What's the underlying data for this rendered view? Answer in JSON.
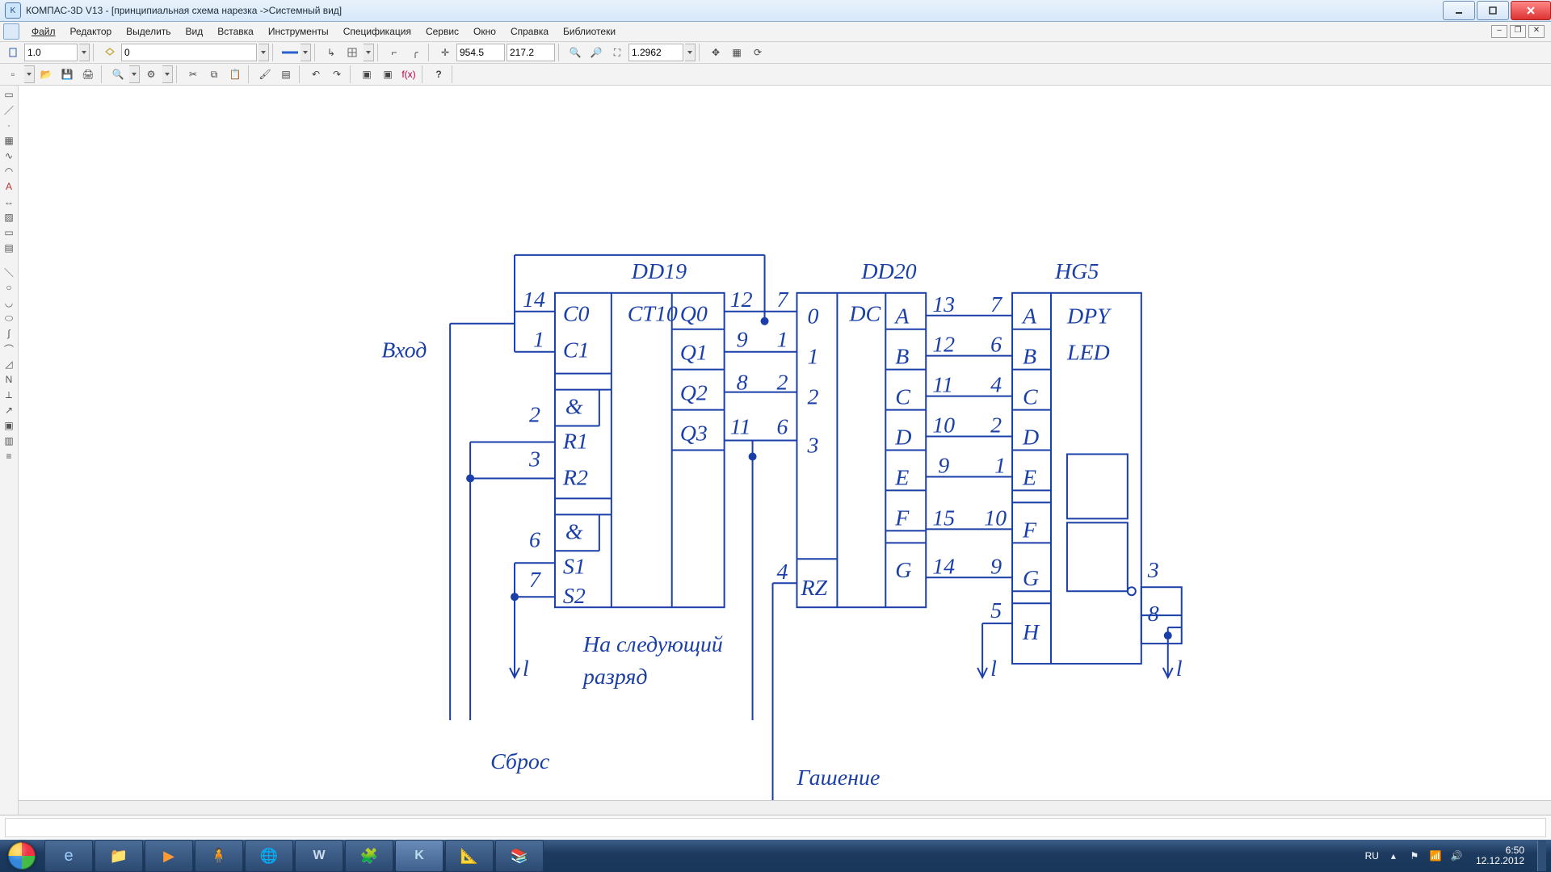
{
  "title": "КОМПАС-3D V13 - [принципиальная схема нарезка ->Системный вид]",
  "menu": [
    "Файл",
    "Редактор",
    "Выделить",
    "Вид",
    "Вставка",
    "Инструменты",
    "Спецификация",
    "Сервис",
    "Окно",
    "Справка",
    "Библиотеки"
  ],
  "toolbar1": {
    "scale": "1.0",
    "layer": "0",
    "coordX": "954.5",
    "coordY": "217.2",
    "zoom": "1.2962"
  },
  "schematic": {
    "labels": {
      "dd19": "DD19",
      "dd20": "DD20",
      "hg5": "HG5",
      "ct10": "CT10",
      "dc": "DC",
      "dpy": "DPY",
      "led": "LED",
      "input": "Вход",
      "next1": "На следующий",
      "next2": "разряд",
      "reset": "Сброс",
      "blank": "Гашение"
    },
    "dd19_left": [
      "C0",
      "C1",
      "&",
      "R1",
      "R2",
      "&",
      "S1",
      "S2"
    ],
    "dd19_leftpins": [
      "14",
      "1",
      "2",
      "3",
      "6",
      "7"
    ],
    "dd19_q": [
      "Q0",
      "Q1",
      "Q2",
      "Q3"
    ],
    "dd19_qpins": [
      "12",
      "9",
      "8",
      "11"
    ],
    "dd20_in": [
      "0",
      "1",
      "2",
      "3",
      "RZ"
    ],
    "dd20_inpins": [
      "7",
      "1",
      "2",
      "6",
      "4"
    ],
    "dd20_out": [
      "A",
      "B",
      "C",
      "D",
      "E",
      "F",
      "G"
    ],
    "dd20_outpins_l": [
      "13",
      "12",
      "11",
      "10",
      "9",
      "15",
      "14"
    ],
    "dd20_outpins_r": [
      "7",
      "6",
      "4",
      "2",
      "1",
      "10",
      "9"
    ],
    "hg5_in": [
      "A",
      "B",
      "C",
      "D",
      "E",
      "F",
      "G",
      "H"
    ],
    "hg5_in_pin_h": "5",
    "hg5_outpins": [
      "3",
      "8"
    ]
  },
  "tray": {
    "lang": "RU",
    "time": "6:50",
    "date": "12.12.2012"
  }
}
